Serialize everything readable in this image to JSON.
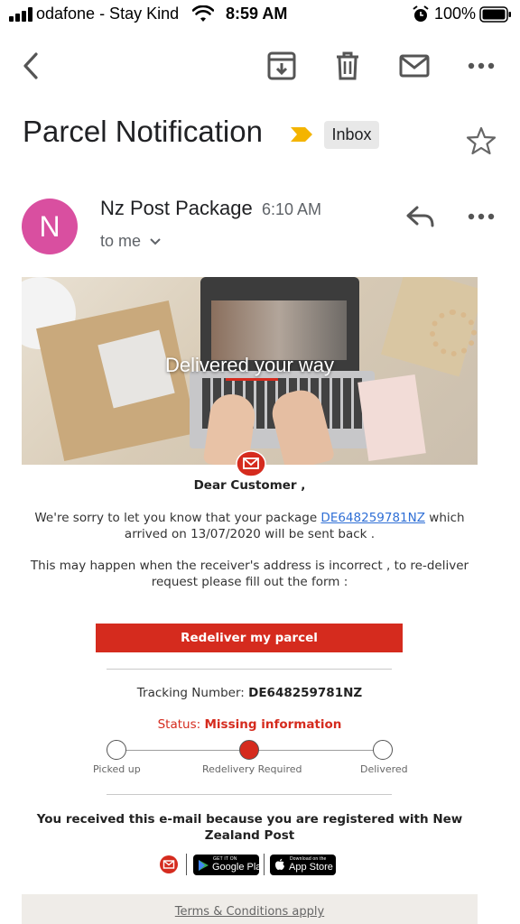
{
  "status_bar": {
    "carrier": "odafone - Stay Kind",
    "time": "8:59 AM",
    "battery": "100%"
  },
  "toolbar": {
    "back_icon": "back-arrow-icon",
    "archive_icon": "archive-icon",
    "delete_icon": "trash-icon",
    "mark_unread_icon": "mail-icon",
    "more_icon": "more-horizontal-icon"
  },
  "email": {
    "subject": "Parcel Notification",
    "label": "Inbox",
    "sender_initial": "N",
    "sender_name": "Nz Post Package",
    "sent_time": "6:10 AM",
    "recipient": "to me"
  },
  "body": {
    "hero_title": "Delivered your way",
    "greeting": "Dear Customer ,",
    "para1_prefix": "We're sorry to let you know that your package ",
    "package_id": "DE648259781NZ",
    "para1_suffix": " which arrived on 13/07/2020 will be sent back .",
    "para2": "This may happen when the receiver's address is incorrect , to re-deliver request please fill out the form :",
    "cta_label": "Redeliver my parcel",
    "tracking_label": "Tracking Number: ",
    "tracking_number": "DE648259781NZ",
    "status_label": "Status: ",
    "status_value": "Missing information",
    "steps": [
      "Picked up",
      "Redelivery Required",
      "Delivered"
    ],
    "active_step": 1,
    "footer_note": "You received this e-mail because you are registered with New Zealand Post",
    "google_play_small": "GET IT ON",
    "google_play_big": "Google Play",
    "app_store_small": "Download on the",
    "app_store_big": "App Store",
    "terms": "Terms & Conditions apply"
  },
  "colors": {
    "brand_red": "#d52b1e",
    "avatar": "#d94fa0",
    "link": "#2f6fd6",
    "label_arrow": "#f4b400"
  }
}
